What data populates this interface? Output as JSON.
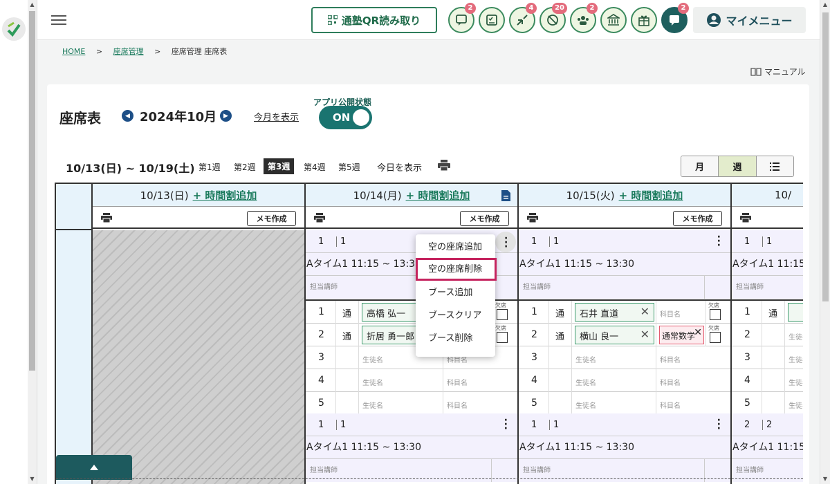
{
  "header": {
    "qr_label": "通塾QR読み取り",
    "icons": [
      {
        "name": "message-icon",
        "badge": "2"
      },
      {
        "name": "checklist-icon",
        "badge": ""
      },
      {
        "name": "transfer-icon",
        "badge": "4"
      },
      {
        "name": "no-entry-icon",
        "badge": "20"
      },
      {
        "name": "group-icon",
        "badge": "2"
      },
      {
        "name": "bank-icon",
        "badge": ""
      },
      {
        "name": "gift-icon",
        "badge": ""
      },
      {
        "name": "chat-icon",
        "badge": "2"
      }
    ],
    "my_menu": "マイメニュー"
  },
  "breadcrumb": {
    "home": "HOME",
    "seat_mgmt": "座席管理",
    "current": "座席管理 座席表",
    "sep": ">"
  },
  "manual": "マニュアル",
  "page": {
    "title": "座席表",
    "month": "2024年10月",
    "this_month": "今月を表示",
    "app_status_label": "アプリ公開状態",
    "toggle": "ON"
  },
  "week": {
    "range": "10/13(日) ~ 10/19(土)",
    "tabs": [
      "第1週",
      "第2週",
      "第3週",
      "第4週",
      "第5週"
    ],
    "active_index": 2,
    "today": "今日を表示"
  },
  "view_switch": [
    "月",
    "週",
    ""
  ],
  "days": [
    {
      "date": "10/13(日)",
      "add": "+ 時間割追加",
      "memo": "メモ作成"
    },
    {
      "date": "10/14(月)",
      "add": "+ 時間割追加",
      "memo": "メモ作成"
    },
    {
      "date": "10/15(火)",
      "add": "+ 時間割追加",
      "memo": "メモ作成"
    },
    {
      "date": "10/",
      "add": "",
      "memo": ""
    }
  ],
  "seat_common": {
    "time": "Aタイム1 11:15 ~ 13:30",
    "teacher_ph": "担当講師",
    "student_ph": "生徒名",
    "subject_ph": "科目名",
    "absent": "欠席",
    "tsu": "通"
  },
  "day1_block1": {
    "head1": "1",
    "head2": "1",
    "students": [
      "高橋 弘一",
      "折居 勇一郎"
    ]
  },
  "day2_block1": {
    "head1": "1",
    "head2": "1",
    "students": [
      "石井 直道",
      "横山 良一"
    ],
    "subject": "通常数学"
  },
  "day3_block1": {
    "head1": "1",
    "head2": "1"
  },
  "block2": {
    "d1h1": "1",
    "d1h2": "1",
    "d2h1": "1",
    "d2h2": "1",
    "d3h1": "2",
    "d3h2": "2"
  },
  "context_menu": [
    "空の座席追加",
    "空の座席削除",
    "ブース追加",
    "ブースクリア",
    "ブース削除"
  ]
}
